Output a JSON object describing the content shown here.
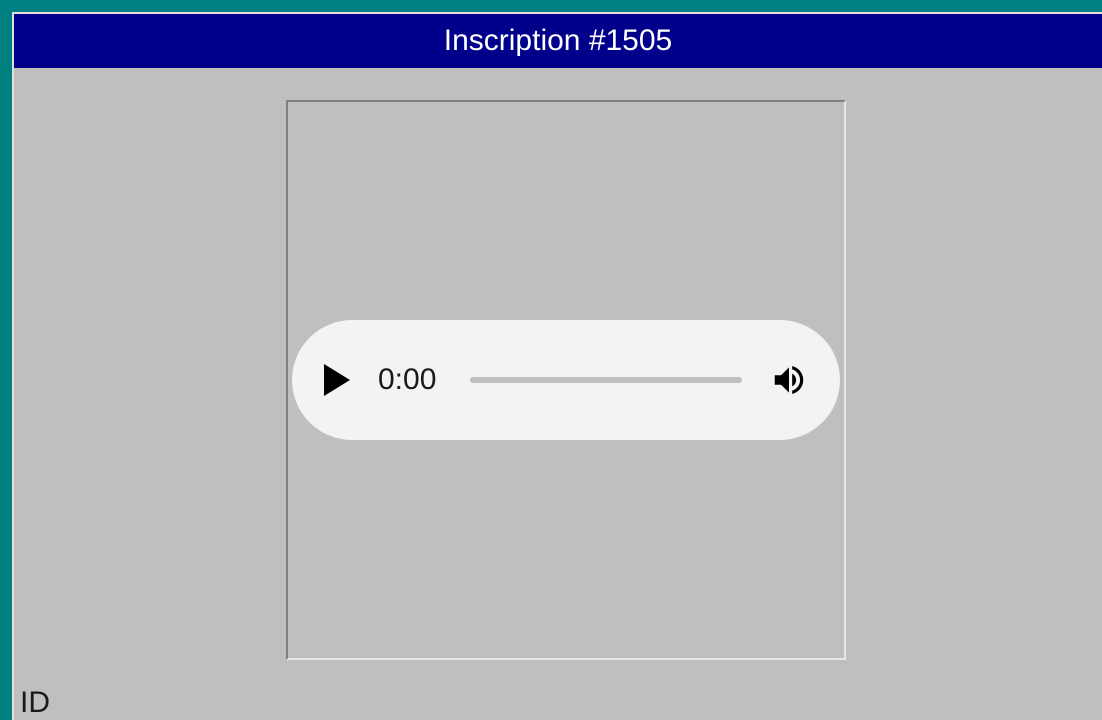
{
  "title": "Inscription #1505",
  "player": {
    "current_time": "0:00"
  },
  "labels": {
    "id": "ID"
  }
}
